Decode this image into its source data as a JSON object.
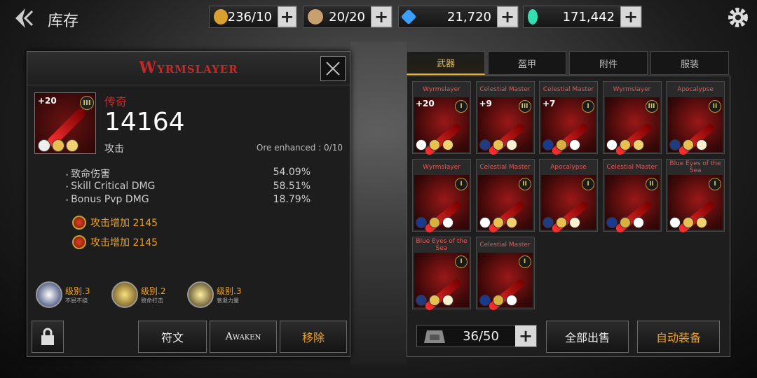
{
  "header": {
    "title": "库存"
  },
  "resources": [
    {
      "name": "stamina",
      "value": "236/10",
      "color": "#d9a030"
    },
    {
      "name": "cookie",
      "value": "20/20",
      "color": "#c8a070"
    },
    {
      "name": "blue-crystal",
      "value": "21,720",
      "color": "#3aa0ff"
    },
    {
      "name": "green-gem",
      "value": "171,442",
      "color": "#30e0b0"
    }
  ],
  "plus_symbol": "+",
  "item": {
    "name": "Wyrmslayer",
    "level": "+20",
    "tier": "III",
    "rarity": "传奇",
    "power": "14164",
    "power_label": "攻击",
    "ore": "Ore enhanced : 0/10",
    "stats": [
      {
        "name": "致命伤害",
        "value": "54.09%"
      },
      {
        "name": "Skill Critical DMG",
        "value": "58.51%"
      },
      {
        "name": "Bonus Pvp DMG",
        "value": "18.79%"
      }
    ],
    "bonuses": [
      "攻击增加 2145",
      "攻击增加 2145"
    ],
    "skills": [
      {
        "level": "级别.3",
        "desc": "不屈不挠"
      },
      {
        "level": "级别.2",
        "desc": "致命打击"
      },
      {
        "level": "级别.3",
        "desc": "衰退力量"
      }
    ]
  },
  "buttons": {
    "rune": "符文",
    "awaken": "Awaken",
    "remove": "移除",
    "sell_all": "全部出售",
    "auto_equip": "自动装备"
  },
  "tabs": [
    {
      "label": "武器",
      "active": true
    },
    {
      "label": "盔甲",
      "active": false
    },
    {
      "label": "附件",
      "active": false
    },
    {
      "label": "服装",
      "active": false
    }
  ],
  "inventory": [
    {
      "name": "Wyrmslayer",
      "level": "+20",
      "tier": "I"
    },
    {
      "name": "Celestial Master",
      "level": "+9",
      "tier": "III"
    },
    {
      "name": "Celestial Master",
      "level": "+7",
      "tier": "I"
    },
    {
      "name": "Wyrmslayer",
      "level": "",
      "tier": "III"
    },
    {
      "name": "Apocalypse",
      "level": "",
      "tier": "II"
    },
    {
      "name": "Wyrmslayer",
      "level": "",
      "tier": "I"
    },
    {
      "name": "Celestial Master",
      "level": "",
      "tier": "II"
    },
    {
      "name": "Apocalypse",
      "level": "",
      "tier": "I"
    },
    {
      "name": "Celestial Master",
      "level": "",
      "tier": "II"
    },
    {
      "name": "Blue Eyes of the Sea",
      "level": "",
      "tier": "I"
    },
    {
      "name": "Blue Eyes of the Sea",
      "level": "",
      "tier": "I"
    },
    {
      "name": "Celestial Master",
      "level": "",
      "tier": "I"
    }
  ],
  "bag": {
    "count": "36/50"
  }
}
